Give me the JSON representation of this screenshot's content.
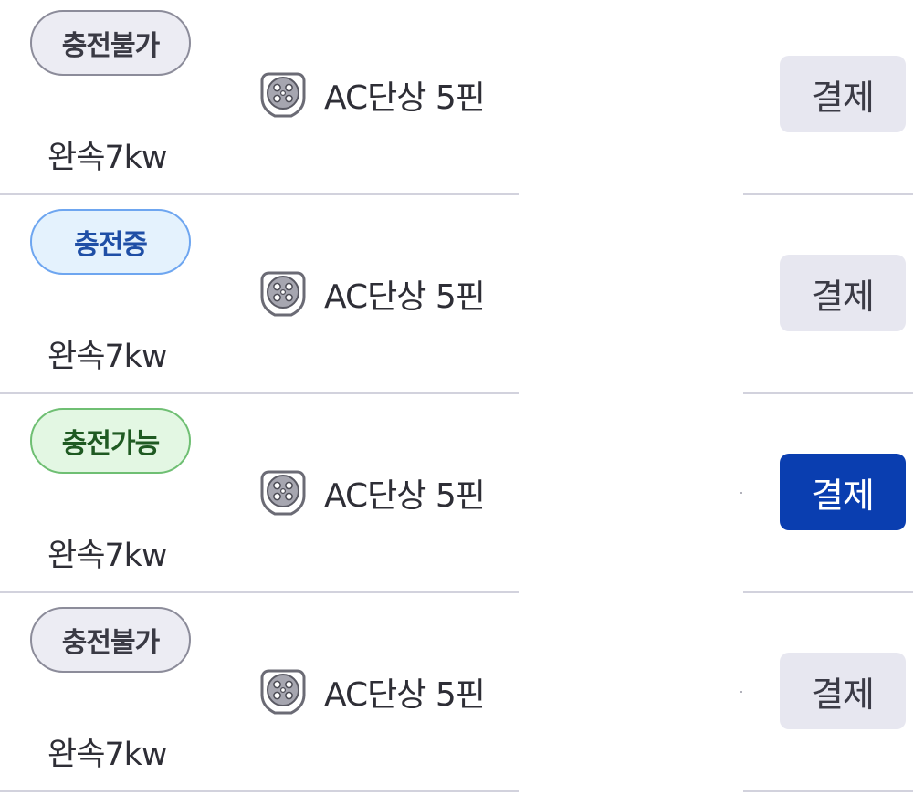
{
  "chargers": [
    {
      "status": "충전불가",
      "status_type": "unavailable",
      "connector_icon": "ac-5pin-connector-icon",
      "connector": "AC단상 5핀",
      "speed": "완속7kw",
      "pay_label": "결제",
      "pay_enabled": false
    },
    {
      "status": "충전중",
      "status_type": "charging",
      "connector_icon": "ac-5pin-connector-icon",
      "connector": "AC단상 5핀",
      "speed": "완속7kw",
      "pay_label": "결제",
      "pay_enabled": false
    },
    {
      "status": "충전가능",
      "status_type": "available",
      "connector_icon": "ac-5pin-connector-icon",
      "connector": "AC단상 5핀",
      "speed": "완속7kw",
      "pay_label": "결제",
      "pay_enabled": true
    },
    {
      "status": "충전불가",
      "status_type": "unavailable",
      "connector_icon": "ac-5pin-connector-icon",
      "connector": "AC단상 5핀",
      "speed": "완속7kw",
      "pay_label": "결제",
      "pay_enabled": false
    }
  ],
  "colors": {
    "unavailable_border": "#8c8c9a",
    "unavailable_bg": "#ececf3",
    "charging_border": "#6ea6f0",
    "charging_bg": "#e4f2fd",
    "available_border": "#6fbf73",
    "available_bg": "#e3f7e3",
    "pay_active": "#0a3eb0",
    "pay_inactive": "#e7e7f0",
    "divider": "#d2d2dd"
  }
}
